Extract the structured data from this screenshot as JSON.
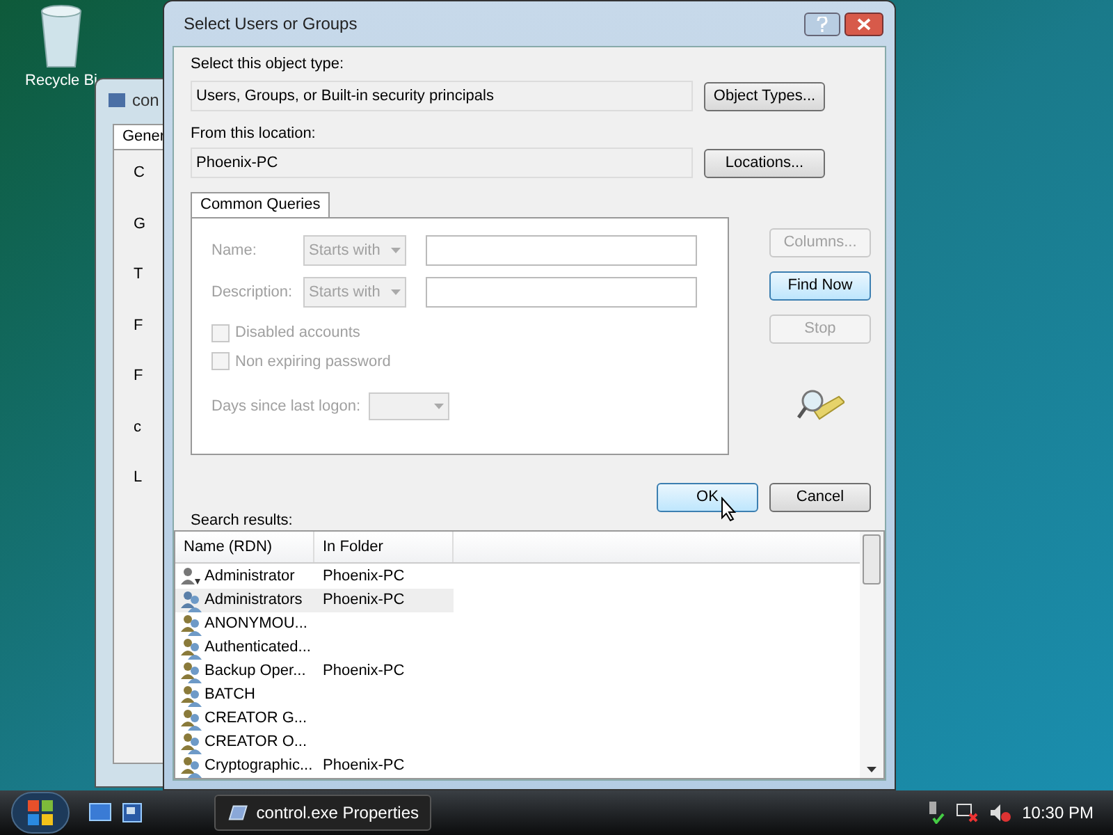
{
  "desktop": {
    "icons": [
      {
        "label": "Recycle Bi"
      }
    ]
  },
  "background_window": {
    "title": "con",
    "tab": "Gener",
    "fragments": [
      "C",
      "G",
      "T",
      "F",
      "F",
      "c",
      "L"
    ]
  },
  "dialog": {
    "title": "Select Users or Groups",
    "object_type": {
      "label": "Select this object type:",
      "value": "Users, Groups, or Built-in security principals",
      "button": "Object Types..."
    },
    "location": {
      "label": "From this location:",
      "value": "Phoenix-PC",
      "button": "Locations..."
    },
    "tabs": [
      {
        "label": "Common Queries",
        "selected": true
      }
    ],
    "queries": {
      "fields": [
        {
          "label": "Name:",
          "operator": "Starts with"
        },
        {
          "label": "Description:",
          "operator": "Starts with"
        }
      ],
      "checkboxes": [
        {
          "label": "Disabled accounts",
          "checked": false,
          "disabled": true
        },
        {
          "label": "Non expiring password",
          "checked": false,
          "disabled": true
        }
      ],
      "days": {
        "label": "Days since last logon:"
      }
    },
    "side_buttons": [
      {
        "label": "Columns...",
        "disabled": true,
        "default": false
      },
      {
        "label": "Find Now",
        "disabled": false,
        "default": true
      },
      {
        "label": "Stop",
        "disabled": true,
        "default": false
      }
    ],
    "ok": {
      "label": "OK",
      "hovered": true
    },
    "cancel": {
      "label": "Cancel",
      "hovered": false
    },
    "results": {
      "label": "Search results:",
      "columns": [
        "Name (RDN)",
        "In Folder"
      ],
      "rows": [
        {
          "name": "Administrator",
          "folder": "Phoenix-PC",
          "kind": "user",
          "highlighted": false
        },
        {
          "name": "Administrators",
          "folder": "Phoenix-PC",
          "kind": "group",
          "highlighted": true
        },
        {
          "name": "ANONYMOU...",
          "kind": "principal",
          "highlighted": false
        },
        {
          "name": "Authenticated...",
          "kind": "principal",
          "highlighted": false
        },
        {
          "name": "Backup Oper...",
          "folder": "Phoenix-PC",
          "kind": "principal",
          "highlighted": false
        },
        {
          "name": "BATCH",
          "kind": "principal",
          "highlighted": false
        },
        {
          "name": "CREATOR G...",
          "kind": "principal",
          "highlighted": false
        },
        {
          "name": "CREATOR O...",
          "kind": "principal",
          "highlighted": false
        },
        {
          "name": "Cryptographic...",
          "folder": "Phoenix-PC",
          "kind": "principal",
          "highlighted": false
        }
      ]
    }
  },
  "taskbar": {
    "tasks": [
      {
        "label": "control.exe Properties"
      }
    ],
    "clock": "10:30 PM"
  }
}
